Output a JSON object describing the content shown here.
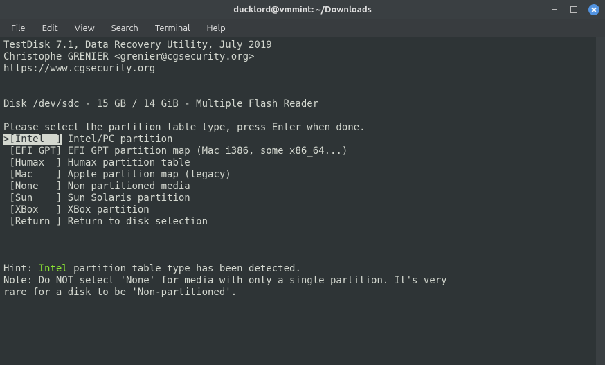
{
  "window": {
    "title": "ducklord@vmmint: ~/Downloads"
  },
  "menus": {
    "file": "File",
    "edit": "Edit",
    "view": "View",
    "search": "Search",
    "terminal": "Terminal",
    "help": "Help"
  },
  "app": {
    "header1": "TestDisk 7.1, Data Recovery Utility, July 2019",
    "header2": "Christophe GRENIER <grenier@cgsecurity.org>",
    "header3": "https://www.cgsecurity.org"
  },
  "disk_line": "Disk /dev/sdc - 15 GB / 14 GiB - Multiple Flash Reader",
  "prompt": "Please select the partition table type, press Enter when done.",
  "options": [
    {
      "key": ">[Intel  ]",
      "desc": " Intel/PC partition",
      "selected": true
    },
    {
      "key": " [EFI GPT]",
      "desc": " EFI GPT partition map (Mac i386, some x86_64...)",
      "selected": false
    },
    {
      "key": " [Humax  ]",
      "desc": " Humax partition table",
      "selected": false
    },
    {
      "key": " [Mac    ]",
      "desc": " Apple partition map (legacy)",
      "selected": false
    },
    {
      "key": " [None   ]",
      "desc": " Non partitioned media",
      "selected": false
    },
    {
      "key": " [Sun    ]",
      "desc": " Sun Solaris partition",
      "selected": false
    },
    {
      "key": " [XBox   ]",
      "desc": " XBox partition",
      "selected": false
    },
    {
      "key": " [Return ]",
      "desc": " Return to disk selection",
      "selected": false
    }
  ],
  "hint": {
    "prefix": "Hint: ",
    "highlight": "Intel",
    "suffix": " partition table type has been detected."
  },
  "note1": "Note: Do NOT select 'None' for media with only a single partition. It's very",
  "note2": "rare for a disk to be 'Non-partitioned'."
}
